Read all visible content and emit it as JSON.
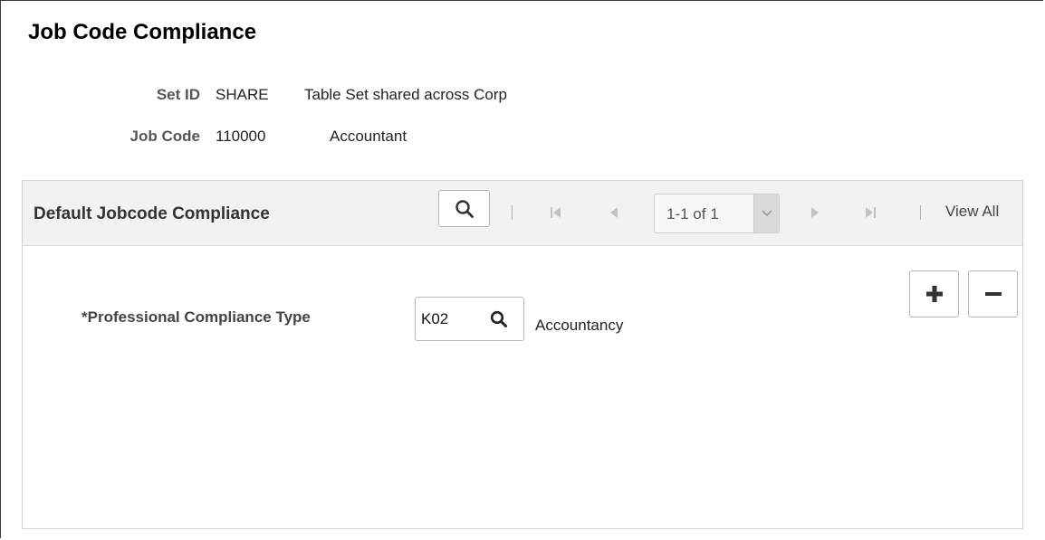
{
  "page": {
    "title": "Job Code Compliance"
  },
  "header_fields": [
    {
      "label": "Set ID",
      "value": "SHARE",
      "description": "Table Set shared across Corp"
    },
    {
      "label": "Job Code",
      "value": "110000",
      "description": "Accountant"
    }
  ],
  "grid": {
    "title": "Default Jobcode Compliance",
    "pager_text": "1-1 of 1",
    "view_all_label": "View All"
  },
  "row": {
    "field_label": "*Professional Compliance Type",
    "field_value": "K02",
    "field_description": "Accountancy"
  },
  "icons": {
    "search": "search-icon",
    "first": "first-page-icon",
    "prev": "previous-page-icon",
    "next": "next-page-icon",
    "last": "last-page-icon",
    "dropdown": "chevron-down-icon",
    "add": "plus-icon",
    "delete": "minus-icon"
  },
  "colors": {
    "text_dark": "#333333",
    "header_bg": "#f2f2f2",
    "disabled_icon": "#c2c2c2"
  }
}
